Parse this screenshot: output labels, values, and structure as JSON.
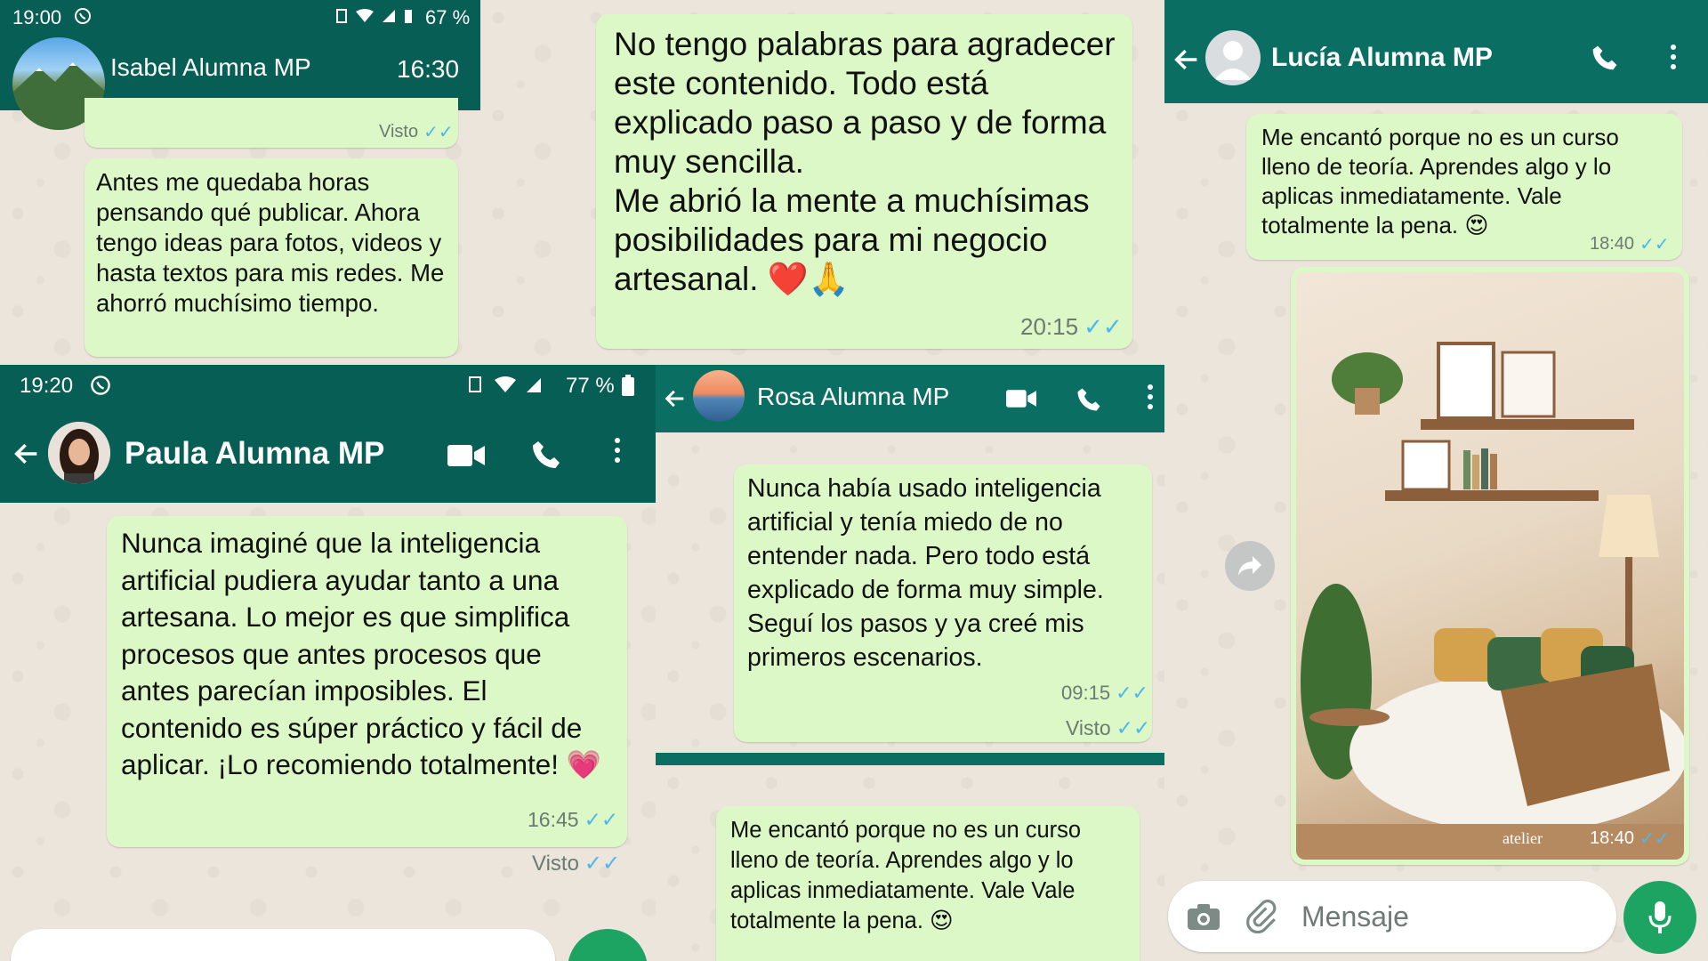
{
  "isabel": {
    "status_time": "19:00",
    "battery": "67 %",
    "contact": "Isabel Alumna MP",
    "header_time": "16:30",
    "prev_visto": "Visto",
    "message": "Antes me quedaba horas pensando qué publicar. Ahora tengo ideas para fotos, videos y hasta textos para mis redes. Me ahorró muchísimo tiempo."
  },
  "center_top": {
    "message": "No tengo palabras para agradecer este contenido. Todo está explicado paso a paso y de forma muy sencilla.\nMe abrió la mente a muchísimas posibilidades para mi negocio artesanal. ❤️🙏",
    "time": "20:15"
  },
  "paula": {
    "status_time": "19:20",
    "battery": "77 %",
    "contact": "Paula Alumna MP",
    "message": "Nunca imaginé que la inteligencia artificial pudiera ayudar tanto a una artesana. Lo mejor es que simplifica procesos que antes procesos que antes parecían imposibles. El contenido es súper práctico y fácil de aplicar. ¡Lo recomiendo totalmente! 💗",
    "time": "16:45",
    "visto": "Visto"
  },
  "rosa": {
    "contact": "Rosa Alumna MP",
    "message": "Nunca había usado inteligencia artificial y tenía miedo de no entender nada. Pero todo está explicado de forma muy simple. Seguí los pasos y ya creé mis primeros escenarios.",
    "time": "09:15",
    "visto": "Visto"
  },
  "bottom_center": {
    "message": "Me encantó porque no es un curso lleno de teoría. Aprendes algo y lo aplicas inmediatamente. Vale Vale totalmente la pena. 😍"
  },
  "lucia": {
    "contact": "Lucía Alumna MP",
    "message": "Me encantó porque no es un curso lleno de teoría. Aprendes algo y lo aplicas inmediatamente. Vale totalmente la pena. 😍",
    "time": "18:40",
    "image_time": "18:40",
    "image_watermark": "atelier",
    "input_placeholder": "Mensaje"
  },
  "colors": {
    "header": "#0b6e63",
    "bubble": "#dcf8c6",
    "ticks": "#4fb6ec",
    "mic": "#1ea462"
  }
}
